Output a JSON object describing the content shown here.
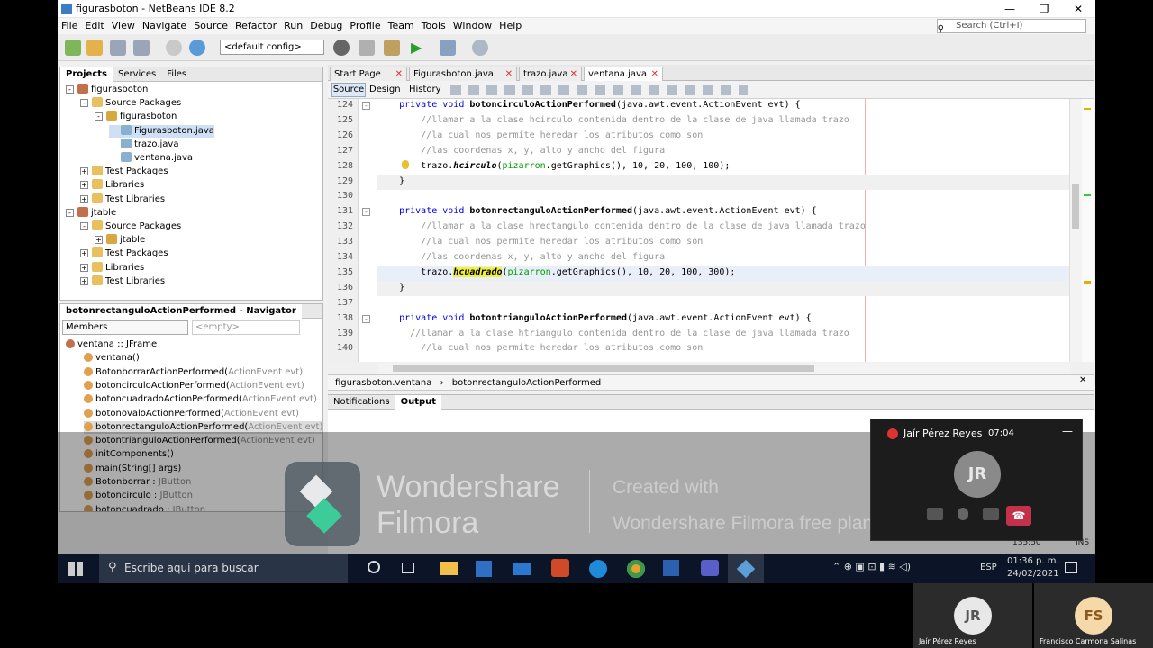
{
  "window": {
    "title": "figurasboton - NetBeans IDE 8.2",
    "min": "—",
    "max": "❐",
    "close": "✕"
  },
  "menu": [
    "File",
    "Edit",
    "View",
    "Navigate",
    "Source",
    "Refactor",
    "Run",
    "Debug",
    "Profile",
    "Team",
    "Tools",
    "Window",
    "Help"
  ],
  "search": {
    "placeholder": "Search (Ctrl+I)"
  },
  "toolbar": {
    "config": "<default config>"
  },
  "projects": {
    "tabs": [
      "Projects",
      "Services",
      "Files"
    ],
    "tree": [
      {
        "label": "figurasboton",
        "icon": "project",
        "x": 6,
        "exp": "-"
      },
      {
        "label": "Source Packages",
        "icon": "folder",
        "x": 22,
        "exp": "-"
      },
      {
        "label": "figurasboton",
        "icon": "package",
        "x": 38,
        "exp": "-"
      },
      {
        "label": "Figurasboton.java",
        "icon": "java",
        "x": 54,
        "exp": "",
        "sel": true
      },
      {
        "label": "trazo.java",
        "icon": "java",
        "x": 54,
        "exp": ""
      },
      {
        "label": "ventana.java",
        "icon": "java",
        "x": 54,
        "exp": ""
      },
      {
        "label": "Test Packages",
        "icon": "folder",
        "x": 22,
        "exp": "+"
      },
      {
        "label": "Libraries",
        "icon": "folder",
        "x": 22,
        "exp": "+"
      },
      {
        "label": "Test Libraries",
        "icon": "folder",
        "x": 22,
        "exp": "+"
      },
      {
        "label": "jtable",
        "icon": "project",
        "x": 6,
        "exp": "-"
      },
      {
        "label": "Source Packages",
        "icon": "folder",
        "x": 22,
        "exp": "-"
      },
      {
        "label": "jtable",
        "icon": "package",
        "x": 38,
        "exp": "+"
      },
      {
        "label": "Test Packages",
        "icon": "folder",
        "x": 22,
        "exp": "+"
      },
      {
        "label": "Libraries",
        "icon": "folder",
        "x": 22,
        "exp": "+"
      },
      {
        "label": "Test Libraries",
        "icon": "folder",
        "x": 22,
        "exp": "+"
      }
    ]
  },
  "navigator": {
    "title": "botonrectanguloActionPerformed - Navigator",
    "members": "Members",
    "empty": "<empty>",
    "items": [
      {
        "name": "ventana :: JFrame",
        "type": "",
        "lvl": 0
      },
      {
        "name": "ventana()",
        "type": "",
        "lvl": 1
      },
      {
        "name": "BotonborrarActionPerformed(",
        "type": "ActionEvent evt)",
        "lvl": 1
      },
      {
        "name": "botoncirculoActionPerformed(",
        "type": "ActionEvent evt)",
        "lvl": 1
      },
      {
        "name": "botoncuadradoActionPerformed(",
        "type": "ActionEvent evt)",
        "lvl": 1
      },
      {
        "name": "botonovaloActionPerformed(",
        "type": "ActionEvent evt)",
        "lvl": 1
      },
      {
        "name": "botonrectanguloActionPerformed(",
        "type": "ActionEvent evt)",
        "lvl": 1,
        "sel": true
      },
      {
        "name": "botontrianguloActionPerformed(",
        "type": "ActionEvent evt)",
        "lvl": 1
      },
      {
        "name": "initComponents()",
        "type": "",
        "lvl": 1
      },
      {
        "name": "main(String[] args)",
        "type": "",
        "lvl": 1
      },
      {
        "name": "Botonborrar : ",
        "type": "JButton",
        "lvl": 1
      },
      {
        "name": "botoncirculo : ",
        "type": "JButton",
        "lvl": 1
      },
      {
        "name": "botoncuadrado : ",
        "type": "JButton",
        "lvl": 1
      }
    ]
  },
  "editor": {
    "tabs": [
      "Start Page",
      "Figurasboton.java",
      "trazo.java",
      "ventana.java"
    ],
    "active": 3,
    "modes": [
      "Source",
      "Design",
      "History"
    ]
  },
  "code": [
    {
      "n": "124",
      "parts": [
        [
          "    ",
          ""
        ],
        [
          "private void ",
          "kw"
        ],
        [
          "botoncirculoActionPerformed",
          "mn"
        ],
        [
          "(java.awt.event.ActionEvent ",
          ""
        ],
        [
          "evt",
          ""
        ],
        [
          ") {",
          ""
        ]
      ],
      "fold": true
    },
    {
      "n": "125",
      "parts": [
        [
          "        //llamar a la clase hcirculo contenida dentro de la clase de java llamada trazo",
          "cm"
        ]
      ]
    },
    {
      "n": "126",
      "parts": [
        [
          "        //la cual nos permite heredar los atributos como son",
          "cm"
        ]
      ]
    },
    {
      "n": "127",
      "parts": [
        [
          "        //las coordenas x, y, alto y ancho del figura",
          "cm"
        ]
      ]
    },
    {
      "n": "128",
      "parts": [
        [
          "        trazo.",
          ""
        ],
        [
          "hcirculo",
          "it"
        ],
        [
          "(",
          ""
        ],
        [
          "pizarron",
          "nv"
        ],
        [
          ".getGraphics(), 10, 20, 100, 100);",
          ""
        ]
      ]
    },
    {
      "n": "129",
      "parts": [
        [
          "    }",
          ""
        ]
      ],
      "shade": true
    },
    {
      "n": "130",
      "parts": []
    },
    {
      "n": "131",
      "parts": [
        [
          "    ",
          ""
        ],
        [
          "private void ",
          "kw"
        ],
        [
          "botonrectanguloActionPerformed",
          "mn"
        ],
        [
          "(java.awt.event.ActionEvent ",
          ""
        ],
        [
          "evt",
          ""
        ],
        [
          ") {",
          ""
        ]
      ],
      "fold": true
    },
    {
      "n": "132",
      "parts": [
        [
          "        //llamar a la clase hrectangulo contenida dentro de la clase de java llamada trazo",
          "cm"
        ]
      ]
    },
    {
      "n": "133",
      "parts": [
        [
          "        //la cual nos permite heredar los atributos como son",
          "cm"
        ]
      ]
    },
    {
      "n": "134",
      "parts": [
        [
          "        //las coordenas x, y, alto y ancho del figura",
          "cm"
        ]
      ]
    },
    {
      "n": "135",
      "parts": [
        [
          "        trazo.",
          ""
        ],
        [
          "hcuadrado",
          "hlit"
        ],
        [
          "(",
          ""
        ],
        [
          "pizarron",
          "nv"
        ],
        [
          ".getGraphics(), 10, 20, 100, 300);",
          ""
        ]
      ],
      "cur": true
    },
    {
      "n": "136",
      "parts": [
        [
          "    }",
          ""
        ]
      ],
      "shade": true
    },
    {
      "n": "137",
      "parts": []
    },
    {
      "n": "138",
      "parts": [
        [
          "    ",
          ""
        ],
        [
          "private void ",
          "kw"
        ],
        [
          "botontrianguloActionPerformed",
          "mn"
        ],
        [
          "(java.awt.event.ActionEvent ",
          ""
        ],
        [
          "evt",
          ""
        ],
        [
          ") {",
          ""
        ]
      ],
      "fold": true
    },
    {
      "n": "139",
      "parts": [
        [
          "      //llamar a la clase htriangulo contenida dentro de la clase de java llamada trazo",
          "cm"
        ]
      ]
    },
    {
      "n": "140",
      "parts": [
        [
          "        //la cual nos permite heredar los atributos como son",
          "cm"
        ]
      ]
    }
  ],
  "breadcrumb": [
    "figurasboton.ventana",
    "botonrectanguloActionPerformed"
  ],
  "output": {
    "tabs": [
      "Notifications",
      "Output"
    ]
  },
  "status": {
    "pos": "135:50",
    "mode": "INS"
  },
  "watermark": {
    "brand1": "Wondershare",
    "brand2": "Filmora",
    "created": "Created with",
    "plan": "Wondershare Filmora free plan"
  },
  "call": {
    "name": "Jaír Pérez Reyes",
    "time": "07:04",
    "initials": "JR"
  },
  "taskbar": {
    "search": "Escribe aquí para buscar",
    "lang": "ESP",
    "time": "01:36 p. m.",
    "date": "24/02/2021"
  },
  "participants": [
    {
      "initials": "JR",
      "name": "Jaír  Pérez Reyes"
    },
    {
      "initials": "FS",
      "name": "Francisco Carmona Salinas"
    }
  ]
}
